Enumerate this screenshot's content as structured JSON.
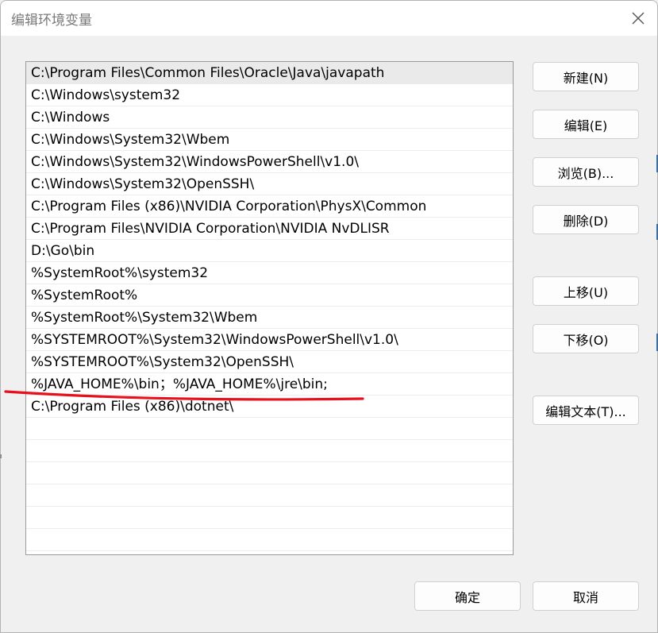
{
  "window": {
    "title": "编辑环境变量"
  },
  "icons": {
    "close": "close-icon"
  },
  "path_list": {
    "items": [
      "C:\\Program Files\\Common Files\\Oracle\\Java\\javapath",
      "C:\\Windows\\system32",
      "C:\\Windows",
      "C:\\Windows\\System32\\Wbem",
      "C:\\Windows\\System32\\WindowsPowerShell\\v1.0\\",
      "C:\\Windows\\System32\\OpenSSH\\",
      "C:\\Program Files (x86)\\NVIDIA Corporation\\PhysX\\Common",
      "C:\\Program Files\\NVIDIA Corporation\\NVIDIA NvDLISR",
      "D:\\Go\\bin",
      "%SystemRoot%\\system32",
      "%SystemRoot%",
      "%SystemRoot%\\System32\\Wbem",
      "%SYSTEMROOT%\\System32\\WindowsPowerShell\\v1.0\\",
      "%SYSTEMROOT%\\System32\\OpenSSH\\",
      "%JAVA_HOME%\\bin；%JAVA_HOME%\\jre\\bin;",
      "C:\\Program Files (x86)\\dotnet\\",
      "",
      "",
      "",
      "",
      "",
      ""
    ],
    "selected_index": 0,
    "highlighted_index": 14
  },
  "buttons": {
    "new": "新建(N)",
    "edit": "编辑(E)",
    "browse": "浏览(B)...",
    "delete": "删除(D)",
    "move_up": "上移(U)",
    "move_down": "下移(O)",
    "edit_text": "编辑文本(T)...",
    "ok": "确定",
    "cancel": "取消"
  },
  "colors": {
    "annotation": "#e8101c",
    "selection": "#eaeaea"
  }
}
